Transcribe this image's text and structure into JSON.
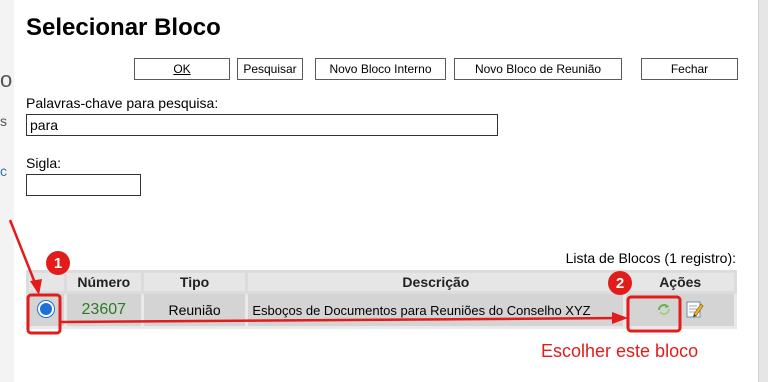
{
  "dialog": {
    "title": "Selecionar Bloco",
    "buttons": {
      "ok": "OK",
      "pesquisar": "Pesquisar",
      "novo_interno": "Novo Bloco Interno",
      "novo_reuniao": "Novo Bloco de Reunião",
      "fechar": "Fechar"
    },
    "fields": {
      "keywords_label": "Palavras-chave para pesquisa:",
      "keywords_value": "para",
      "sigla_label": "Sigla:",
      "sigla_value": ""
    }
  },
  "table": {
    "caption": "Lista de Blocos (1 registro):",
    "headers": [
      "Número",
      "Tipo",
      "Descrição",
      "Ações"
    ],
    "rows": [
      {
        "selected": true,
        "numero": "23607",
        "tipo": "Reunião",
        "descricao": "Esboços de Documentos para Reuniões do Conselho XYZ"
      }
    ]
  },
  "annotations": {
    "badge1": "1",
    "badge2": "2",
    "label": "Escolher este bloco",
    "color": "#e21b1b"
  },
  "background_edge": {
    "glyphs": [
      "o",
      "s",
      "c"
    ]
  },
  "icons": [
    "radio-selected-icon",
    "choose-block-icon",
    "edit-block-icon"
  ]
}
